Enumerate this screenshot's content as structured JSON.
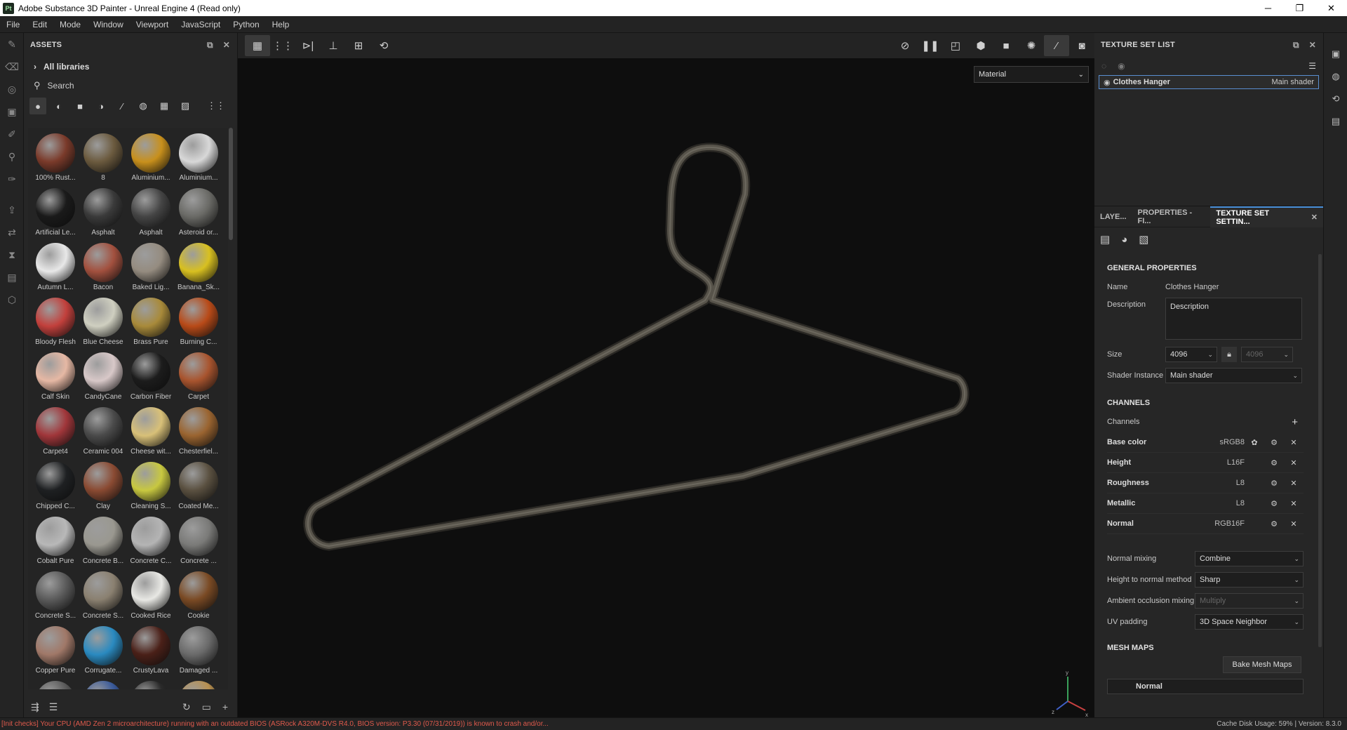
{
  "titlebar": {
    "app_icon": "Pt",
    "title": "Adobe Substance 3D Painter - Unreal Engine 4 (Read only)",
    "minimize": "─",
    "maximize": "❐",
    "close": "✕"
  },
  "menu": [
    "File",
    "Edit",
    "Mode",
    "Window",
    "Viewport",
    "JavaScript",
    "Python",
    "Help"
  ],
  "assets": {
    "title": "ASSETS",
    "library": "All libraries",
    "search_placeholder": "Search",
    "items": [
      {
        "name": "100% Rust...",
        "color": "#7a3a2a"
      },
      {
        "name": "8",
        "color": "#6b5a3e"
      },
      {
        "name": "Aluminium...",
        "color": "#c8901c"
      },
      {
        "name": "Aluminium...",
        "color": "#d8d8d8"
      },
      {
        "name": "Artificial Le...",
        "color": "#1a1a1a"
      },
      {
        "name": "Asphalt",
        "color": "#3a3a3a"
      },
      {
        "name": "Asphalt",
        "color": "#444444"
      },
      {
        "name": "Asteroid or...",
        "color": "#6a6a66"
      },
      {
        "name": "Autumn L...",
        "color": "#e8e8e8"
      },
      {
        "name": "Bacon",
        "color": "#a2503e"
      },
      {
        "name": "Baked Lig...",
        "color": "#958c80"
      },
      {
        "name": "Banana_Sk...",
        "color": "#d8c020"
      },
      {
        "name": "Bloody Flesh",
        "color": "#c2403c"
      },
      {
        "name": "Blue Cheese",
        "color": "#cfcfc0"
      },
      {
        "name": "Brass Pure",
        "color": "#a88a3a"
      },
      {
        "name": "Burning C...",
        "color": "#b84a18"
      },
      {
        "name": "Calf Skin",
        "color": "#e6b8a4"
      },
      {
        "name": "CandyCane",
        "color": "#d8c8c8"
      },
      {
        "name": "Carbon Fiber",
        "color": "#1c1c1c"
      },
      {
        "name": "Carpet",
        "color": "#a8542e"
      },
      {
        "name": "Carpet4",
        "color": "#a0363a"
      },
      {
        "name": "Ceramic 004",
        "color": "#4a4a4a"
      },
      {
        "name": "Cheese wit...",
        "color": "#d8c078"
      },
      {
        "name": "Chesterfiel...",
        "color": "#9a6430"
      },
      {
        "name": "Chipped C...",
        "color": "#1e2022"
      },
      {
        "name": "Clay",
        "color": "#8a4a32"
      },
      {
        "name": "Cleaning S...",
        "color": "#c8c840"
      },
      {
        "name": "Coated Me...",
        "color": "#5a5040"
      },
      {
        "name": "Cobalt Pure",
        "color": "#b8b8b8"
      },
      {
        "name": "Concrete B...",
        "color": "#9a9890"
      },
      {
        "name": "Concrete C...",
        "color": "#b4b4b4"
      },
      {
        "name": "Concrete ...",
        "color": "#7a7a78"
      },
      {
        "name": "Concrete S...",
        "color": "#5a5a5a"
      },
      {
        "name": "Concrete S...",
        "color": "#8a8070"
      },
      {
        "name": "Cooked Rice",
        "color": "#e8e8e4"
      },
      {
        "name": "Cookie",
        "color": "#7a4a24"
      },
      {
        "name": "Copper Pure",
        "color": "#a07868"
      },
      {
        "name": "Corrugate...",
        "color": "#2a8ac0"
      },
      {
        "name": "CrustyLava",
        "color": "#4a2018"
      },
      {
        "name": "Damaged ...",
        "color": "#6a6a6a"
      },
      {
        "name": "",
        "color": "#5a5a5a"
      },
      {
        "name": "",
        "color": "#3a5a9a"
      },
      {
        "name": "",
        "color": "#2a2a2a"
      },
      {
        "name": "",
        "color": "#b89050"
      }
    ]
  },
  "viewport": {
    "material_mode": "Material"
  },
  "texture_set_list": {
    "title": "TEXTURE SET LIST",
    "set_name": "Clothes Hanger",
    "shader": "Main shader"
  },
  "tsset": {
    "tabs": [
      "LAYE...",
      "PROPERTIES - FI...",
      "TEXTURE SET SETTIN..."
    ],
    "general": "GENERAL PROPERTIES",
    "name_label": "Name",
    "name_value": "Clothes Hanger",
    "description_label": "Description",
    "description_value": "Description",
    "size_label": "Size",
    "size_value": "4096",
    "size_value2": "4096",
    "shader_label": "Shader Instance",
    "shader_value": "Main shader",
    "channels_title": "CHANNELS",
    "channels_label": "Channels",
    "channels": [
      {
        "name": "Base color",
        "format": "sRGB8"
      },
      {
        "name": "Height",
        "format": "L16F"
      },
      {
        "name": "Roughness",
        "format": "L8"
      },
      {
        "name": "Metallic",
        "format": "L8"
      },
      {
        "name": "Normal",
        "format": "RGB16F"
      }
    ],
    "normal_mixing_label": "Normal mixing",
    "normal_mixing_value": "Combine",
    "h2n_label": "Height to normal method",
    "h2n_value": "Sharp",
    "ao_label": "Ambient occlusion mixing",
    "ao_value": "Multiply",
    "uv_label": "UV padding",
    "uv_value": "3D Space Neighbor",
    "mesh_maps_title": "MESH MAPS",
    "bake_button": "Bake Mesh Maps",
    "mesh_map_first": "Normal"
  },
  "status": {
    "message": "[Init checks] Your CPU (AMD Zen 2 microarchitecture) running with an outdated BIOS (ASRock A320M-DVS R4.0, BIOS version: P3.30 (07/31/2019)) is known to crash and/or...",
    "cache": "Cache Disk Usage:  59% | Version: 8.3.0"
  }
}
